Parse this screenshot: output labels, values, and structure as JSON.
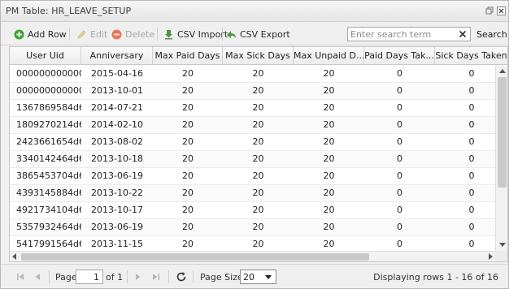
{
  "window": {
    "title": "PM Table: HR_LEAVE_SETUP"
  },
  "toolbar": {
    "add_label": "Add Row",
    "edit_label": "Edit",
    "delete_label": "Delete",
    "csv_import_label": "CSV Import",
    "csv_export_label": "CSV Export",
    "search_placeholder": "Enter search term",
    "search_label": "Search"
  },
  "grid": {
    "columns": [
      "User Uid",
      "Anniversary",
      "Max Paid Days",
      "Max Sick Days",
      "Max Unpaid D...",
      "Paid Days Tak...",
      "Sick Days Taken"
    ],
    "rows": [
      [
        "000000000000...",
        "2015-04-16",
        "20",
        "20",
        "20",
        "0",
        "0"
      ],
      [
        "000000000000...",
        "2013-10-01",
        "20",
        "20",
        "20",
        "0",
        "0"
      ],
      [
        "1367869584d6...",
        "2014-07-21",
        "20",
        "20",
        "20",
        "0",
        "0"
      ],
      [
        "1809270214d6...",
        "2014-02-10",
        "20",
        "20",
        "20",
        "0",
        "0"
      ],
      [
        "2423661654d6...",
        "2013-08-02",
        "20",
        "20",
        "20",
        "0",
        "0"
      ],
      [
        "3340142464d6...",
        "2013-10-18",
        "20",
        "20",
        "20",
        "0",
        "0"
      ],
      [
        "3865453704d6...",
        "2013-06-19",
        "20",
        "20",
        "20",
        "0",
        "0"
      ],
      [
        "4393145884d6...",
        "2013-10-22",
        "20",
        "20",
        "20",
        "0",
        "0"
      ],
      [
        "4921734104d6...",
        "2013-10-17",
        "20",
        "20",
        "20",
        "0",
        "0"
      ],
      [
        "5357932464d6...",
        "2013-06-19",
        "20",
        "20",
        "20",
        "0",
        "0"
      ],
      [
        "5417991564d6...",
        "2013-11-15",
        "20",
        "20",
        "20",
        "0",
        "0"
      ]
    ]
  },
  "pager": {
    "page_label": "Page",
    "page_value": "1",
    "of_label": "of 1",
    "page_size_label": "Page Size:",
    "page_size_value": "20",
    "status": "Displaying rows 1 - 16 of 16"
  },
  "colors": {
    "add": "#3aa534",
    "delete": "#e05a3a",
    "csv": "#4a9a3a"
  }
}
